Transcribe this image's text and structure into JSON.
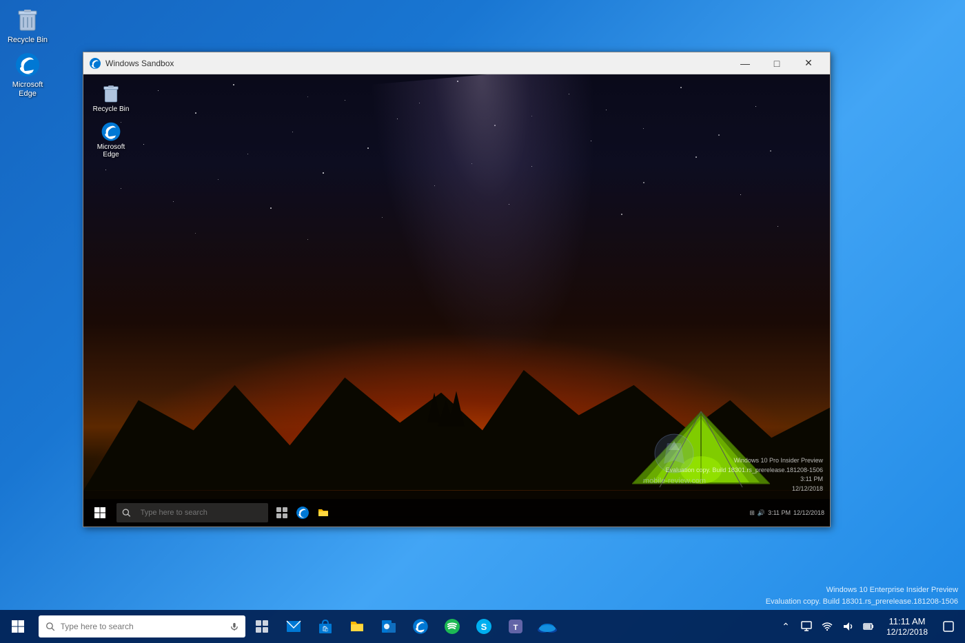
{
  "desktop": {
    "icons": [
      {
        "id": "recycle-bin",
        "label": "Recycle Bin"
      },
      {
        "id": "microsoft-edge",
        "label": "Microsoft Edge"
      }
    ]
  },
  "sandbox_window": {
    "title": "Windows Sandbox",
    "controls": {
      "minimize": "—",
      "maximize": "□",
      "close": "✕"
    },
    "inner_taskbar": {
      "search_placeholder": "Type here to search",
      "apps": [
        "task-view",
        "edge",
        "file-explorer"
      ]
    },
    "inner_icons": [
      {
        "id": "recycle-bin",
        "label": "Recycle Bin"
      },
      {
        "id": "microsoft-edge",
        "label": "Microsoft Edge"
      }
    ],
    "watermark": {
      "line1": "Windows 10 Pro Insider Preview",
      "line2": "Evaluation copy. Build 18301.rs_prerelease.181208-1506",
      "line3": "3:11 PM",
      "line4": "12/12/2018"
    }
  },
  "mobile_review": {
    "text": "mobile-review.com"
  },
  "main_taskbar": {
    "search_placeholder": "Type here to search",
    "clock": {
      "time": "11:11 AM",
      "date": "12/12/2018"
    },
    "bottom_watermark": {
      "line1": "Windows 10 Enterprise Insider Preview",
      "line2": "Evaluation copy. Build 18301.rs_prerelease.181208-1506"
    }
  }
}
